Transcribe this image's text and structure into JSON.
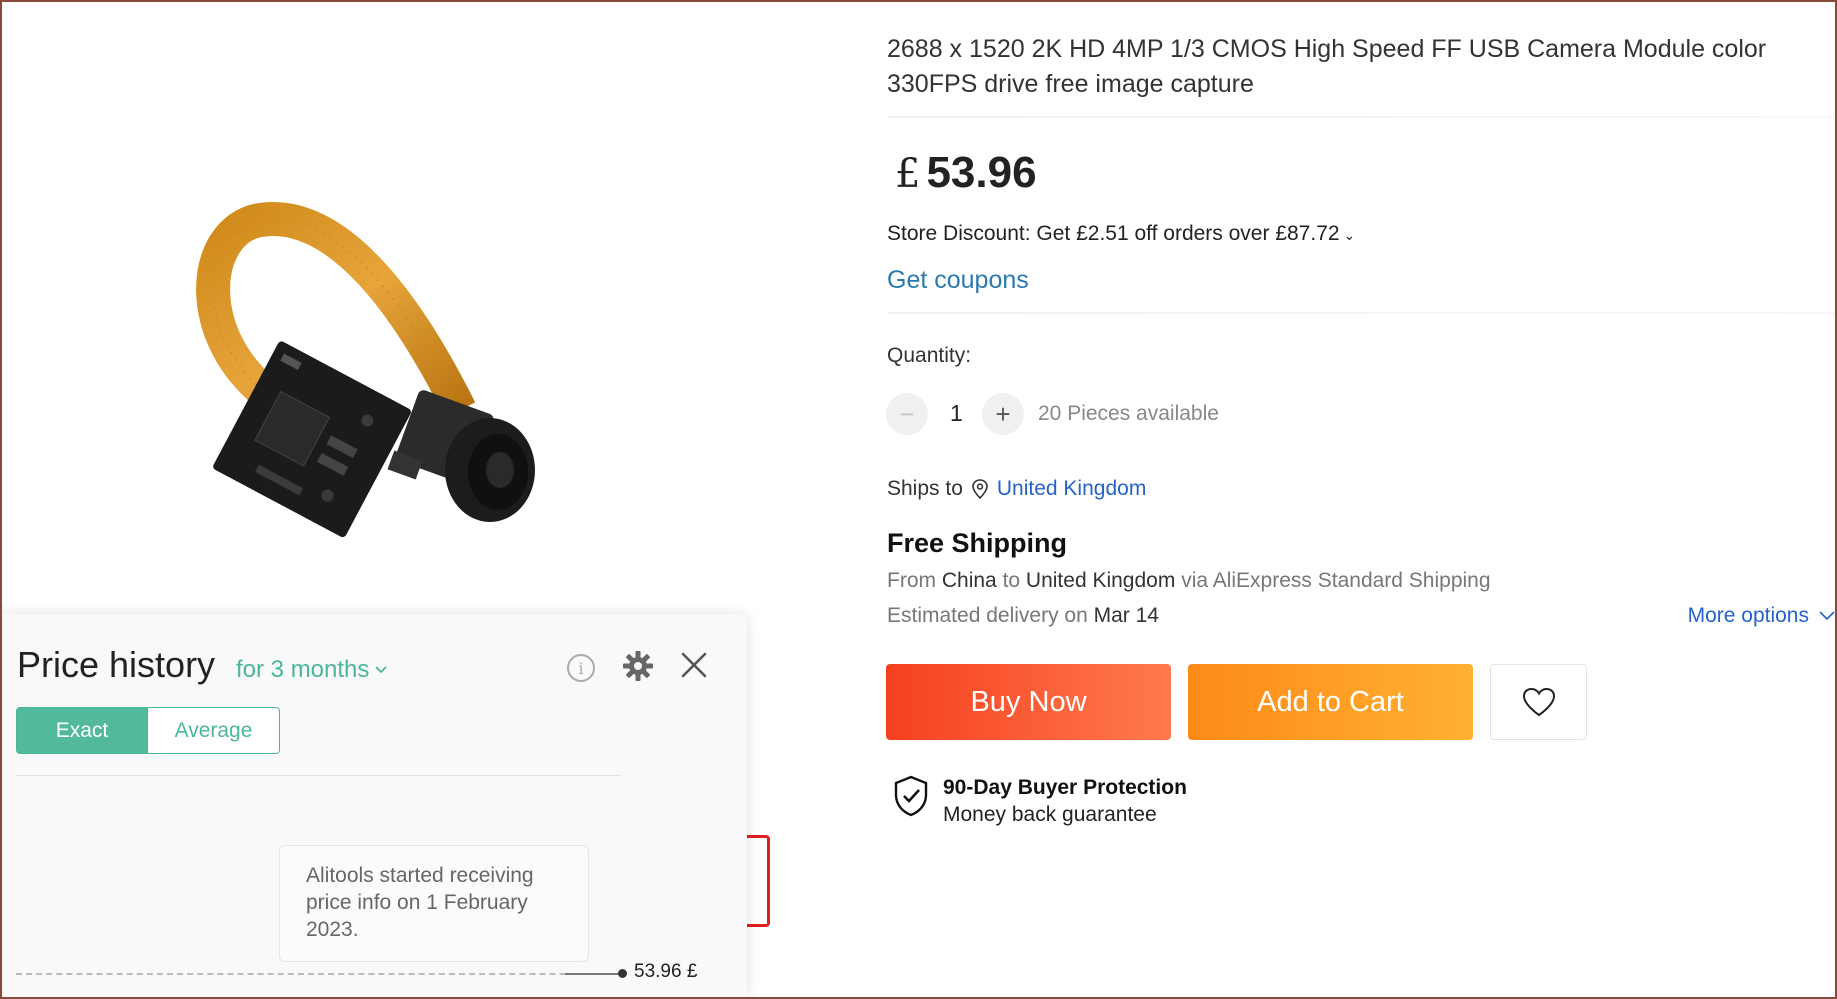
{
  "product": {
    "title": "2688 x 1520 2K HD 4MP 1/3 CMOS High Speed FF USB Camera Module color 330FPS drive free image capture",
    "currency_symbol": "£",
    "price": "53.96",
    "store_discount": "Store Discount: Get  £2.51 off orders over  £87.72",
    "get_coupons": "Get coupons",
    "quantity_label": "Quantity:",
    "quantity_value": "1",
    "available": "20 Pieces available",
    "ships_to_label": "Ships to",
    "ships_to_location": "United Kingdom",
    "free_shipping": "Free Shipping",
    "from_prefix": "From",
    "from_country": "China",
    "to_word": "to",
    "to_country": "United Kingdom",
    "via_text": "via AliExpress Standard Shipping",
    "eta_prefix": "Estimated delivery on",
    "eta_date": "Mar 14",
    "more_options": "More options",
    "buy_now": "Buy Now",
    "add_to_cart": "Add to Cart",
    "protection_title": "90-Day Buyer Protection",
    "protection_sub": "Money back guarantee"
  },
  "price_history": {
    "title": "Price history",
    "period": "for 3 months",
    "tab_exact": "Exact",
    "tab_average": "Average",
    "tooltip": "Alitools started receiving price info on 1 February 2023.",
    "current_price_label": "53.96 £"
  },
  "icons": {
    "location": "location-pin-icon",
    "heart": "heart-icon",
    "shield": "shield-check-icon",
    "gear": "gear-icon",
    "close": "close-icon",
    "info": "info-icon"
  },
  "colors": {
    "buy_now": "#f5401e",
    "add_to_cart": "#fd8a17",
    "link": "#2563c9",
    "accent_green": "#52b99c"
  }
}
